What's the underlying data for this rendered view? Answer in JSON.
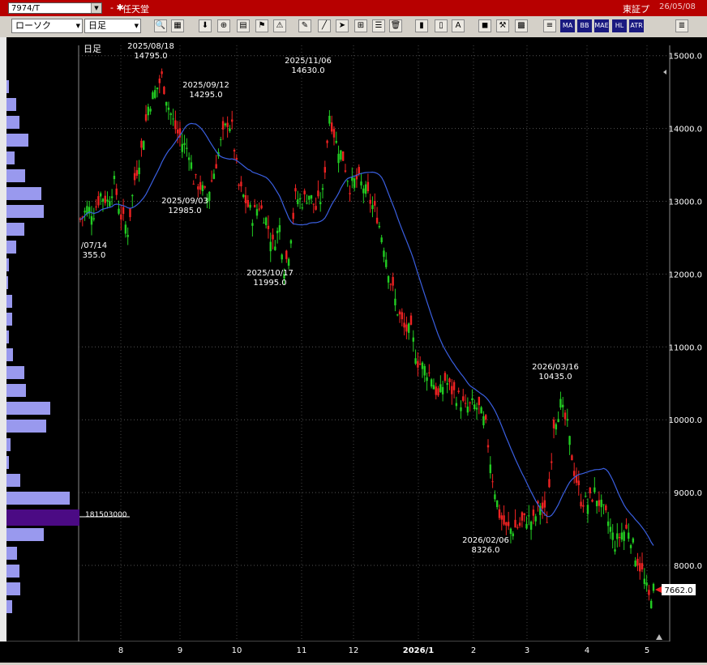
{
  "titlebar": {
    "code": "7974/T",
    "mark": "- ✱",
    "name": "任天堂",
    "market": "東証プ",
    "date": "26/05/08"
  },
  "toolbar": {
    "chart_type": "ローソク",
    "period": "日足",
    "text_buttons": [
      "MA",
      "BB",
      "MAE",
      "HL",
      "ATR"
    ],
    "icons": [
      "search-icon",
      "grid-icon",
      "arrow-down-icon",
      "zoom-icon",
      "table-icon",
      "flag-icon",
      "warning-icon",
      "pen-icon",
      "line-tool-icon",
      "cursor-icon",
      "ruler-icon",
      "list-icon",
      "trash-icon",
      "candle-icon",
      "candle2-icon",
      "all-icon",
      "box-icon",
      "wrench-icon",
      "palette-icon",
      "data-icon",
      "menu-icon"
    ]
  },
  "chart_data": {
    "type": "candlestick",
    "period_label": "日足",
    "y_ticks": [
      8000,
      9000,
      10000,
      11000,
      12000,
      13000,
      14000,
      15000
    ],
    "y_tick_labels": [
      "8000.0",
      "9000.0",
      "10000.0",
      "11000.0",
      "12000.0",
      "13000.0",
      "14000.0",
      "15000.0"
    ],
    "x_labels": [
      "8",
      "9",
      "10",
      "11",
      "12",
      "2026/1",
      "2",
      "3",
      "4",
      "5"
    ],
    "current_price": "7662.0",
    "volume_profile_marker": "181503000",
    "annotations": [
      {
        "date": "/07/14",
        "price": "355.0"
      },
      {
        "date": "2025/08/18",
        "price": "14795.0"
      },
      {
        "date": "2025/09/12",
        "price": "14295.0"
      },
      {
        "date": "2025/09/03",
        "price": "12985.0"
      },
      {
        "date": "2025/10/17",
        "price": "11995.0"
      },
      {
        "date": "2025/11/06",
        "price": "14630.0"
      },
      {
        "date": "2026/02/06",
        "price": "8326.0"
      },
      {
        "date": "2026/03/16",
        "price": "10435.0"
      }
    ],
    "price_path": [
      [
        0,
        12750
      ],
      [
        3,
        12900
      ],
      [
        6,
        12850
      ],
      [
        9,
        13100
      ],
      [
        12,
        13000
      ],
      [
        15,
        13250
      ],
      [
        18,
        12800
      ],
      [
        21,
        12600
      ],
      [
        24,
        13300
      ],
      [
        27,
        13700
      ],
      [
        30,
        14300
      ],
      [
        33,
        14500
      ],
      [
        36,
        14700
      ],
      [
        39,
        14300
      ],
      [
        42,
        14000
      ],
      [
        45,
        13800
      ],
      [
        48,
        13700
      ],
      [
        50,
        13300
      ],
      [
        53,
        13200
      ],
      [
        56,
        13050
      ],
      [
        59,
        13400
      ],
      [
        62,
        13800
      ],
      [
        65,
        14100
      ],
      [
        67,
        14000
      ],
      [
        70,
        13200
      ],
      [
        73,
        13000
      ],
      [
        76,
        12800
      ],
      [
        79,
        12950
      ],
      [
        82,
        12750
      ],
      [
        85,
        12400
      ],
      [
        88,
        12650
      ],
      [
        90,
        12100
      ],
      [
        92,
        12300
      ],
      [
        95,
        13050
      ],
      [
        98,
        13000
      ],
      [
        101,
        13100
      ],
      [
        104,
        12900
      ],
      [
        107,
        13100
      ],
      [
        110,
        14200
      ],
      [
        113,
        13800
      ],
      [
        116,
        13600
      ],
      [
        119,
        13200
      ],
      [
        122,
        13300
      ],
      [
        125,
        13200
      ],
      [
        128,
        13000
      ],
      [
        131,
        12800
      ],
      [
        134,
        12400
      ],
      [
        137,
        11900
      ],
      [
        140,
        11500
      ],
      [
        143,
        11250
      ],
      [
        146,
        11200
      ],
      [
        149,
        10800
      ],
      [
        152,
        10700
      ],
      [
        155,
        10600
      ],
      [
        158,
        10300
      ],
      [
        161,
        10550
      ],
      [
        164,
        10400
      ],
      [
        167,
        10300
      ],
      [
        170,
        10150
      ],
      [
        173,
        10200
      ],
      [
        176,
        10150
      ],
      [
        179,
        9900
      ],
      [
        182,
        9200
      ],
      [
        185,
        8700
      ],
      [
        188,
        8500
      ],
      [
        191,
        8500
      ],
      [
        194,
        8550
      ],
      [
        197,
        8650
      ],
      [
        200,
        8600
      ],
      [
        203,
        8850
      ],
      [
        206,
        8650
      ],
      [
        209,
        9950
      ],
      [
        212,
        10200
      ],
      [
        215,
        9900
      ],
      [
        218,
        9300
      ],
      [
        221,
        8900
      ],
      [
        224,
        8850
      ],
      [
        227,
        9000
      ],
      [
        230,
        8800
      ],
      [
        233,
        8600
      ],
      [
        236,
        8300
      ],
      [
        239,
        8450
      ],
      [
        242,
        8500
      ],
      [
        245,
        8150
      ],
      [
        248,
        7900
      ],
      [
        251,
        7550
      ],
      [
        253,
        7662
      ]
    ]
  }
}
